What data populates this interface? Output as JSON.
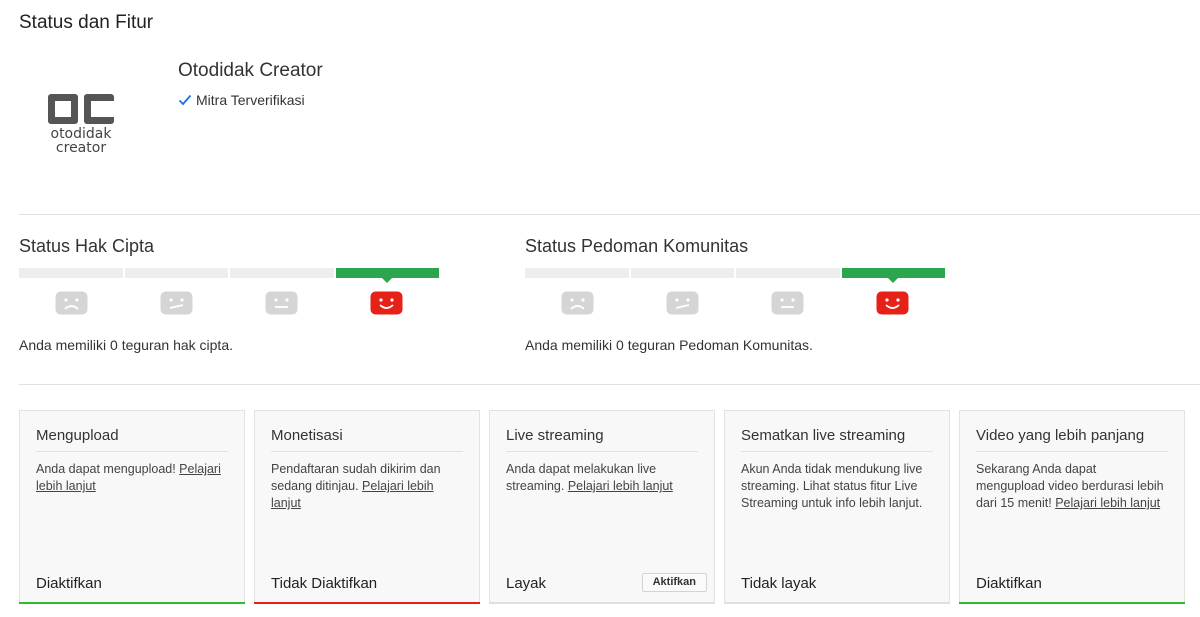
{
  "page": {
    "title": "Status dan Fitur"
  },
  "channel": {
    "name": "Otodidak Creator",
    "verified_label": "Mitra Terverifikasi",
    "logo": {
      "mark": "OC",
      "line1": "otodidak",
      "line2": "creator"
    }
  },
  "copyright": {
    "title": "Status Hak Cipta",
    "message": "Anda memiliki 0 teguran hak cipta.",
    "strikes": 0,
    "levels": 4,
    "active_level": 4
  },
  "community": {
    "title": "Status Pedoman Komunitas",
    "message": "Anda memiliki 0 teguran Pedoman Komunitas.",
    "strikes": 0,
    "levels": 4,
    "active_level": 4
  },
  "features": [
    {
      "title": "Mengupload",
      "text": "Anda dapat mengupload! ",
      "link": "Pelajari lebih lanjut",
      "status": "Diaktifkan",
      "status_color": "green"
    },
    {
      "title": "Monetisasi",
      "text": "Pendaftaran sudah dikirim dan sedang ditinjau. ",
      "link": "Pelajari lebih lanjut",
      "status": "Tidak Diaktifkan",
      "status_color": "red"
    },
    {
      "title": "Live streaming",
      "text": "Anda dapat melakukan live streaming. ",
      "link": "Pelajari lebih lanjut",
      "status": "Layak",
      "status_color": "gray",
      "button": "Aktifkan"
    },
    {
      "title": "Sematkan live streaming",
      "text": "Akun Anda tidak mendukung live streaming. Lihat status fitur Live Streaming untuk info lebih lanjut.",
      "link": "",
      "status": "Tidak layak",
      "status_color": "gray"
    },
    {
      "title": "Video yang lebih panjang",
      "text": "Sekarang Anda dapat mengupload video berdurasi lebih dari 15 menit! ",
      "link": "Pelajari lebih lanjut",
      "status": "Diaktifkan",
      "status_color": "green"
    }
  ],
  "colors": {
    "accent_green": "#2ba64f",
    "enabled_green": "#2fbb2f",
    "disabled_red": "#e62117",
    "face_gray": "#d5d5d5",
    "face_red": "#e62117",
    "check_blue": "#1a73e8"
  }
}
